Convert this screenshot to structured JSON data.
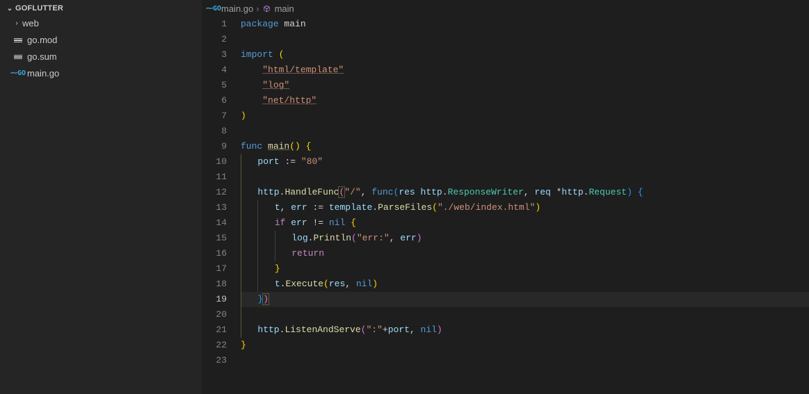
{
  "sidebar": {
    "root": "GOFLUTTER",
    "items": [
      {
        "name": "web",
        "type": "folder"
      },
      {
        "name": "go.mod",
        "type": "mod"
      },
      {
        "name": "go.sum",
        "type": "mod"
      },
      {
        "name": "main.go",
        "type": "go"
      }
    ]
  },
  "breadcrumb": {
    "file": "main.go",
    "symbol": "main"
  },
  "editor": {
    "lineCount": 23,
    "currentLine": 19
  },
  "code": {
    "l1": {
      "kw": "package",
      "name": "main"
    },
    "l3": {
      "kw": "import",
      "paren": "("
    },
    "l4": "\"html/template\"",
    "l5": "\"log\"",
    "l6": "\"net/http\"",
    "l7": ")",
    "l9": {
      "kw": "func",
      "name": "main",
      "paren": "()",
      "brace": "{"
    },
    "l10": {
      "var": "port",
      "op": ":=",
      "val": "\"80\""
    },
    "l12_a": "http",
    "l12_b": "HandleFunc",
    "l12_c": "\"/\"",
    "l12_d": "func",
    "l12_e": "res",
    "l12_f": "http",
    "l12_g": "ResponseWriter",
    "l12_h": "req",
    "l12_i": "http",
    "l12_j": "Request",
    "l13_a": "t",
    "l13_b": "err",
    "l13_c": "template",
    "l13_d": "ParseFiles",
    "l13_e": "\"./web/index.html\"",
    "l14_a": "if",
    "l14_b": "err",
    "l14_c": "nil",
    "l15_a": "log",
    "l15_b": "Println",
    "l15_c": "\"err:\"",
    "l15_d": "err",
    "l16": "return",
    "l18_a": "t",
    "l18_b": "Execute",
    "l18_c": "res",
    "l18_d": "nil",
    "l21_a": "http",
    "l21_b": "ListenAndServe",
    "l21_c": "\":\"",
    "l21_d": "port",
    "l21_e": "nil"
  }
}
